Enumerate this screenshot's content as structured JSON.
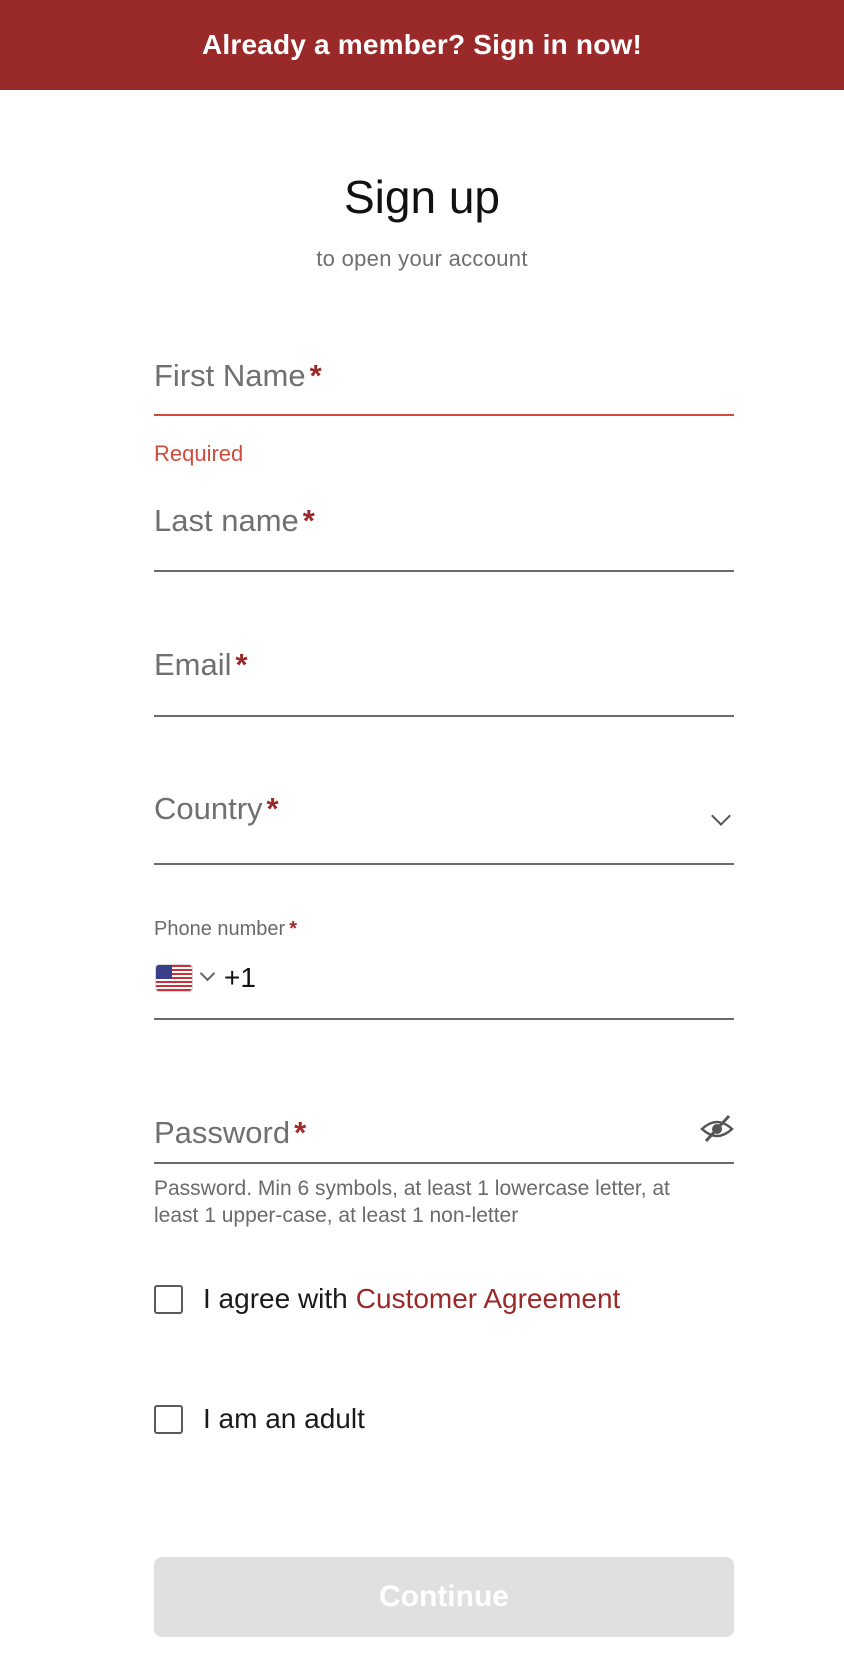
{
  "banner": {
    "text": "Already a member? Sign in now!"
  },
  "header": {
    "title": "Sign up",
    "subtitle": "to open your account"
  },
  "form": {
    "first_name": {
      "label": "First Name",
      "required_mark": "*",
      "error": "Required"
    },
    "last_name": {
      "label": "Last name",
      "required_mark": "*"
    },
    "email": {
      "label": "Email",
      "required_mark": "*"
    },
    "country": {
      "label": "Country",
      "required_mark": "*"
    },
    "phone": {
      "label": "Phone number",
      "required_mark": "*",
      "country_flag": "us-flag-icon",
      "code": "+1"
    },
    "password": {
      "label": "Password",
      "required_mark": "*",
      "hint": "Password. Min 6 symbols, at least 1 lowercase letter, at least 1 upper-case, at least 1 non-letter"
    },
    "agreement": {
      "text": "I agree with",
      "link": "Customer Agreement"
    },
    "adult": {
      "text": "I am an adult"
    },
    "continue_label": "Continue"
  },
  "colors": {
    "brand": "#9a2a2a",
    "error": "#d34b3a",
    "disabled_button": "#e0e0e0"
  }
}
